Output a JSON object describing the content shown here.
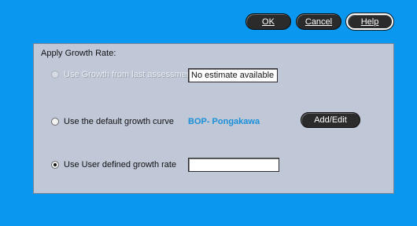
{
  "toolbar": {
    "ok_label": "OK",
    "cancel_label": "Cancel",
    "help_label": "Help"
  },
  "panel": {
    "title": "Apply Growth Rate:",
    "options": [
      {
        "label": "Use Growth from last assessment",
        "state": "disabled",
        "field_value": "No estimate available"
      },
      {
        "label": "Use the default growth curve",
        "state": "unselected",
        "curve_name": "BOP- Pongakawa",
        "button_label": "Add/Edit"
      },
      {
        "label": "Use User defined growth rate",
        "state": "selected",
        "field_value": ""
      }
    ]
  },
  "colors": {
    "background": "#0a97f0",
    "panel": "#c0c8d8",
    "button": "#2b2b2b",
    "curve_text": "#1a8fd8"
  }
}
